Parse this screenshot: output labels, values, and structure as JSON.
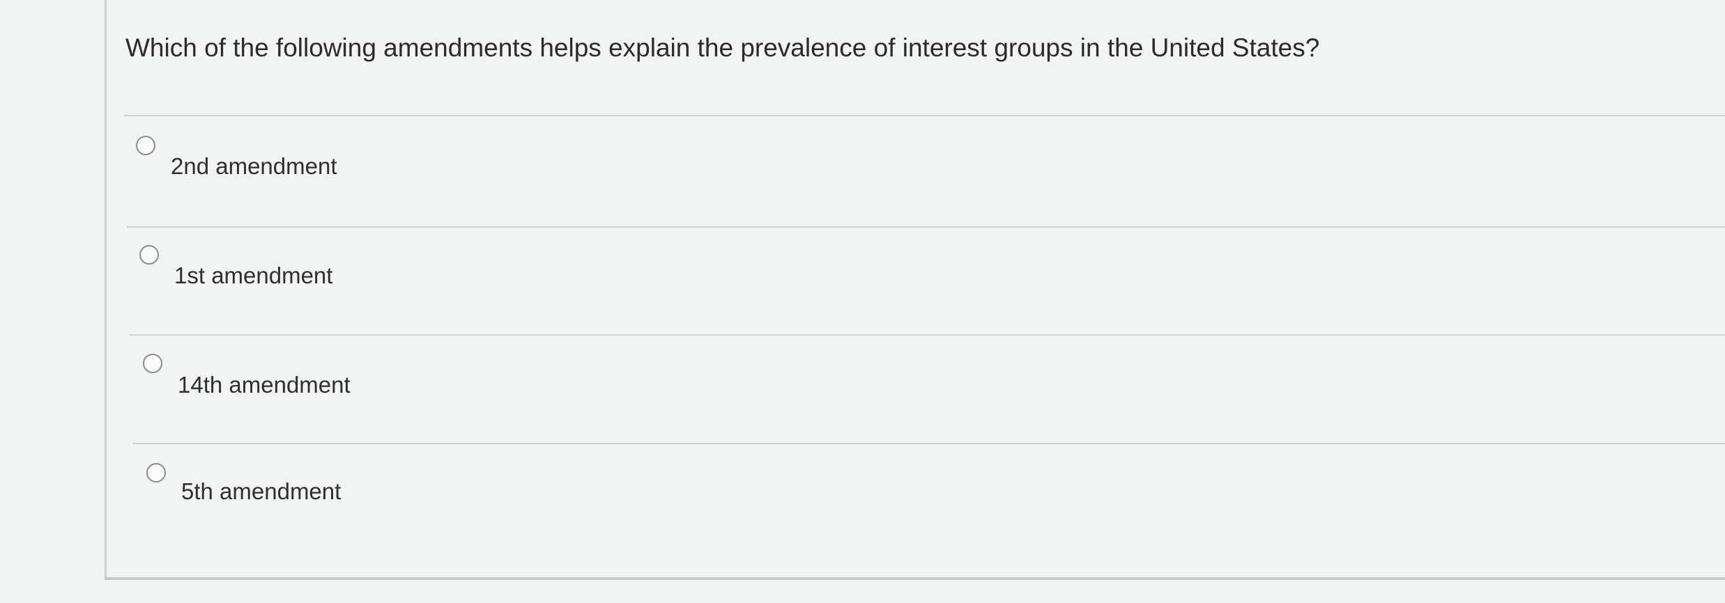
{
  "question": {
    "text": "Which of the following amendments helps explain the prevalence of interest groups in the United States?"
  },
  "options": [
    {
      "label": "2nd amendment",
      "selected": false
    },
    {
      "label": "1st amendment",
      "selected": false
    },
    {
      "label": "14th amendment",
      "selected": false
    },
    {
      "label": "5th amendment",
      "selected": false
    }
  ]
}
